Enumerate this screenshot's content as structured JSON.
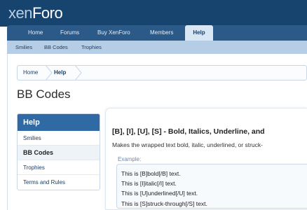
{
  "logo": {
    "part1": "xen",
    "part2": "Foro"
  },
  "nav": {
    "tabs": [
      {
        "label": "Home"
      },
      {
        "label": "Forums"
      },
      {
        "label": "Buy XenForo"
      },
      {
        "label": "Members"
      },
      {
        "label": "Help"
      }
    ],
    "active_tab": "Help"
  },
  "subnav": {
    "items": [
      {
        "label": "Smilies"
      },
      {
        "label": "BB Codes"
      },
      {
        "label": "Trophies"
      }
    ]
  },
  "breadcrumb": {
    "items": [
      {
        "label": "Home"
      },
      {
        "label": "Help"
      }
    ]
  },
  "page_title": "BB Codes",
  "sidebar": {
    "heading": "Help",
    "items": [
      {
        "label": "Smilies"
      },
      {
        "label": "BB Codes"
      },
      {
        "label": "Trophies"
      },
      {
        "label": "Terms and Rules"
      }
    ],
    "active_item": "BB Codes"
  },
  "content": {
    "section_title": "[B], [I], [U], [S] - Bold, Italics, Underline, and",
    "description": "Makes the wrapped text bold, italic, underlined, or struck-",
    "example_label": "Example:",
    "example_lines": [
      "This is [B]bold[/B] text.",
      "This is [I]italic[/I] text.",
      "This is [U]underlined[/U] text.",
      "This is [S]struck-through[/S] text."
    ]
  },
  "colors": {
    "header_bg": "#17446f",
    "nav_bg": "#2b5988",
    "subnav_bg": "#b6cde6",
    "sidebar_head_bg": "#2f6aa4",
    "link": "#1d3f66"
  }
}
